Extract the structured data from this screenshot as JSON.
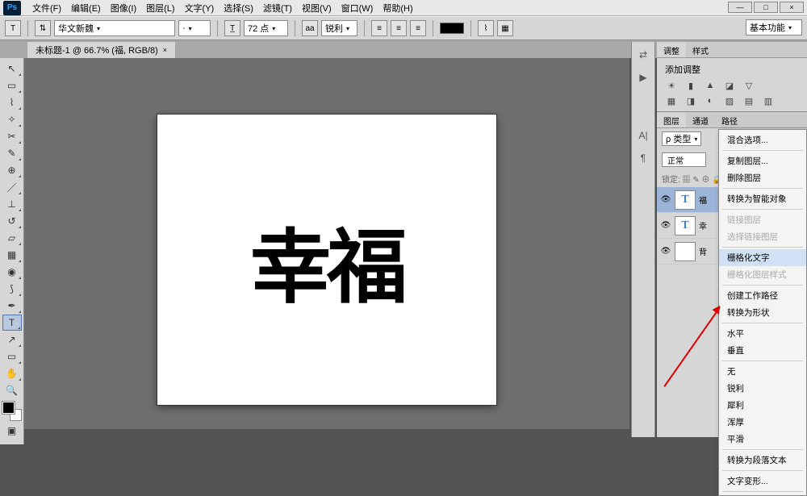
{
  "logo": "Ps",
  "menu": [
    "文件(F)",
    "编辑(E)",
    "图像(I)",
    "图层(L)",
    "文字(Y)",
    "选择(S)",
    "滤镜(T)",
    "视图(V)",
    "窗口(W)",
    "帮助(H)"
  ],
  "win": {
    "min": "—",
    "max": "□",
    "close": "×"
  },
  "opt": {
    "orient": "⇅",
    "font": "华文新魏",
    "style": "·",
    "size": "72 点",
    "aa": "aa",
    "sharp": "锐利",
    "alignL": "≡",
    "alignC": "≡",
    "alignR": "≡",
    "warp": "⌇",
    "panel": "▦"
  },
  "workspace": "基本功能",
  "doc_tab": "未标题-1 @ 66.7% (福, RGB/8)",
  "canvas_text": "幸福",
  "collapse": [
    "⇄",
    "▶",
    "⋮",
    "A|",
    "¶"
  ],
  "adj": {
    "tab1": "调整",
    "tab2": "样式",
    "title": "添加调整",
    "r1": [
      "☀",
      "▮",
      "▲",
      "◪",
      "▽"
    ],
    "r2": [
      "▦",
      "◨",
      "◐",
      "▨",
      "▤",
      "▥"
    ]
  },
  "layers": {
    "tabs": [
      "图层",
      "通道",
      "路径"
    ],
    "kind": "ρ 类型",
    "mode": "正常",
    "lock": "锁定: ▦ ✎ ⊕ 🔒",
    "items": [
      {
        "eye": "👁",
        "thumb": "T",
        "name": "福"
      },
      {
        "eye": "👁",
        "thumb": "T",
        "name": "幸"
      },
      {
        "eye": "👁",
        "thumb": "",
        "name": "背"
      }
    ]
  },
  "ctx": [
    {
      "t": "混合选项...",
      "e": 1
    },
    {
      "sep": 1
    },
    {
      "t": "复制图层...",
      "e": 1
    },
    {
      "t": "删除图层",
      "e": 1
    },
    {
      "sep": 1
    },
    {
      "t": "转换为智能对象",
      "e": 1
    },
    {
      "sep": 1
    },
    {
      "t": "链接图层",
      "e": 0
    },
    {
      "t": "选择链接图层",
      "e": 0
    },
    {
      "sep": 1
    },
    {
      "t": "栅格化文字",
      "e": 1,
      "hl": 1
    },
    {
      "t": "栅格化图层样式",
      "e": 0
    },
    {
      "sep": 1
    },
    {
      "t": "创建工作路径",
      "e": 1
    },
    {
      "t": "转换为形状",
      "e": 1
    },
    {
      "sep": 1
    },
    {
      "t": "水平",
      "e": 1
    },
    {
      "t": "垂直",
      "e": 1
    },
    {
      "sep": 1
    },
    {
      "t": "无",
      "e": 1
    },
    {
      "t": "锐利",
      "e": 1
    },
    {
      "t": "犀利",
      "e": 1
    },
    {
      "t": "浑厚",
      "e": 1
    },
    {
      "t": "平滑",
      "e": 1
    },
    {
      "sep": 1
    },
    {
      "t": "转换为段落文本",
      "e": 1
    },
    {
      "sep": 1
    },
    {
      "t": "文字变形...",
      "e": 1
    },
    {
      "sep": 1
    }
  ]
}
